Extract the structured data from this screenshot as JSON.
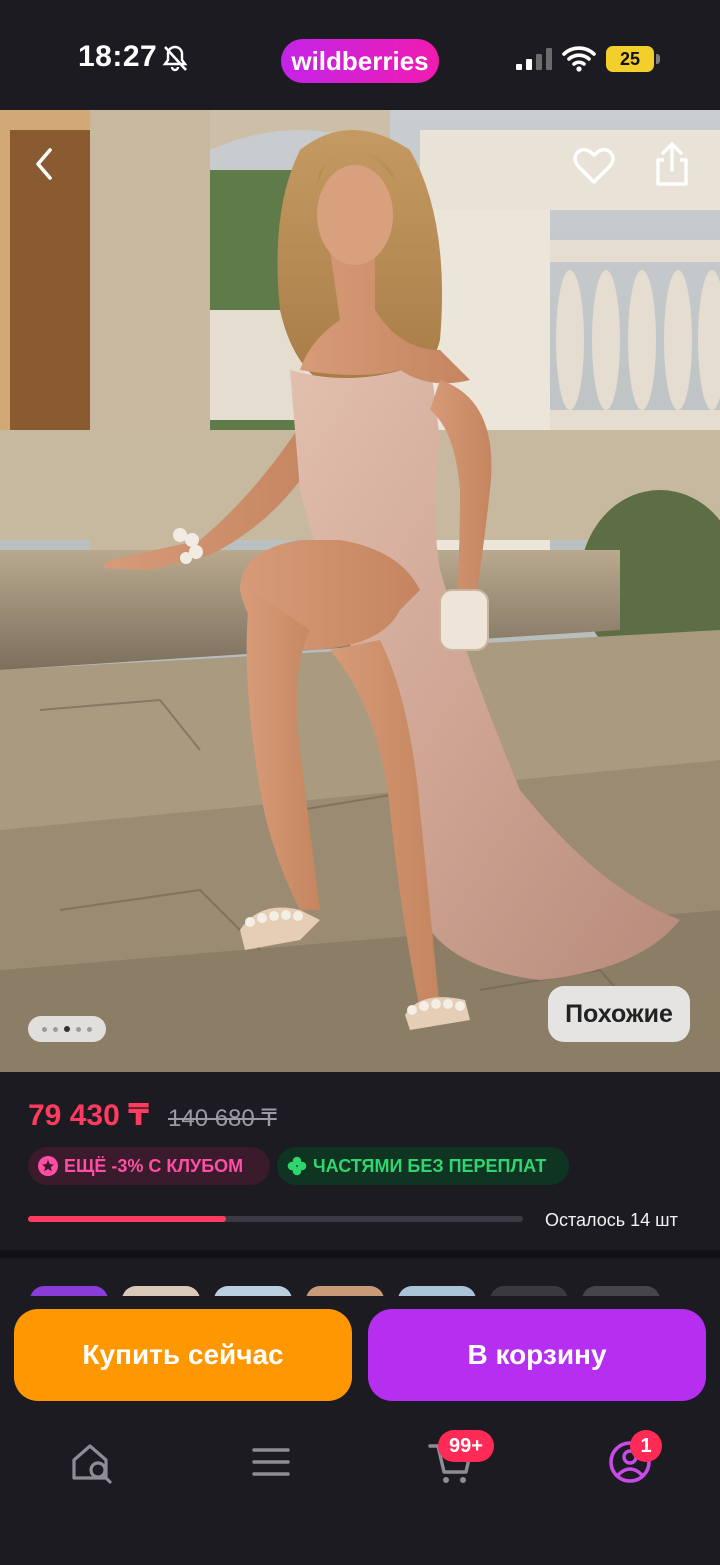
{
  "status_bar": {
    "time": "18:27",
    "brand": "wildberries",
    "battery": "25"
  },
  "product": {
    "photo_nav": {
      "current_index": 3,
      "total": 5
    },
    "similar_label": "Похожие",
    "price": "79 430 ₸",
    "old_price": "140 680 ₸",
    "badges": [
      "ЕЩЁ -3% С КЛУБОМ",
      "ЧАСТЯМИ БЕЗ ПЕРЕПЛАТ"
    ],
    "stock": {
      "text": "Осталось 14 шт",
      "level": 0.4
    }
  },
  "actions": {
    "buy_now": "Купить сейчас",
    "add_to_cart": "В корзину"
  },
  "bottom_nav": {
    "cart_count": "99+",
    "profile_count": "1"
  },
  "colors": {
    "price": "#ff3b5f",
    "buy": "#ff9800",
    "cart": "#b62ef0",
    "brand": "#d423d6",
    "club": "#ff4ea3",
    "parts": "#2fd56f"
  },
  "icons": [
    "bell-slash-icon",
    "signal-icon",
    "wifi-icon",
    "battery-icon",
    "back-icon",
    "heart-icon",
    "share-icon",
    "club-star-icon",
    "clover-icon",
    "home-search-icon",
    "menu-icon",
    "cart-icon",
    "profile-icon"
  ]
}
